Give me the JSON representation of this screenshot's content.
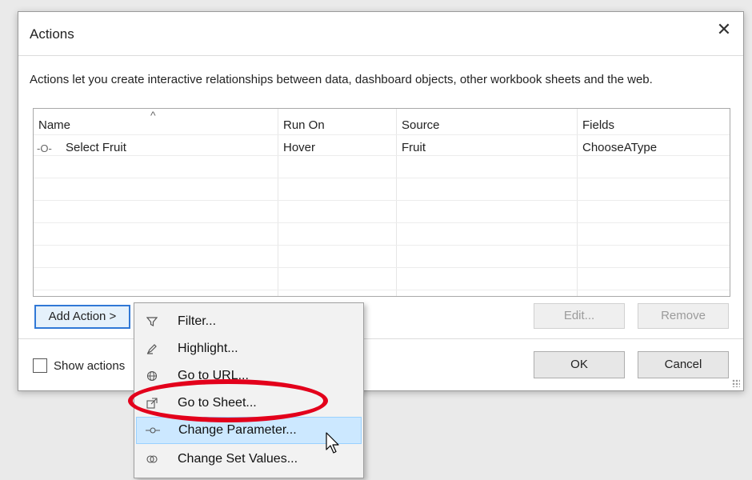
{
  "dialog": {
    "title": "Actions",
    "close_glyph": "✕",
    "description": "Actions let you create interactive relationships between data, dashboard objects, other workbook sheets and the web."
  },
  "table": {
    "sort_indicator": "^",
    "columns": [
      "Name",
      "Run On",
      "Source",
      "Fields"
    ],
    "rows": [
      {
        "icon": "change-parameter-icon",
        "glyph": "-O-",
        "name": "Select Fruit",
        "run_on": "Hover",
        "source": "Fruit",
        "fields": "ChooseAType"
      }
    ]
  },
  "buttons": {
    "add_action": "Add Action >",
    "edit": "Edit...",
    "remove": "Remove",
    "ok": "OK",
    "cancel": "Cancel"
  },
  "show_actions": {
    "label": "Show actions",
    "checked": false
  },
  "menu": {
    "items": [
      {
        "label": "Filter...",
        "icon": "filter-icon"
      },
      {
        "label": "Highlight...",
        "icon": "highlight-pen-icon"
      },
      {
        "label": "Go to URL...",
        "icon": "globe-icon"
      },
      {
        "label": "Go to Sheet...",
        "icon": "go-to-sheet-icon"
      },
      {
        "label": "Change Parameter...",
        "icon": "change-parameter-icon",
        "highlighted": true
      },
      {
        "label": "Change Set Values...",
        "icon": "set-values-icon"
      }
    ]
  },
  "annotation": {
    "color": "#e3001b",
    "target": "Go to Sheet..."
  },
  "colors": {
    "menu_highlight": "#cce8ff",
    "focus_border": "#3078d6"
  }
}
